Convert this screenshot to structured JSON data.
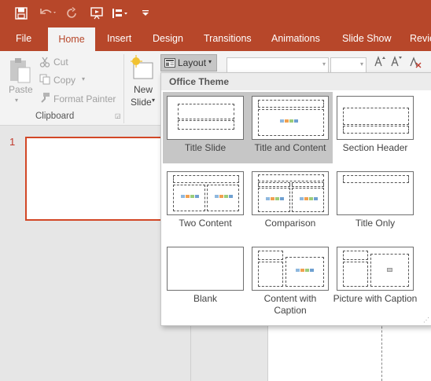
{
  "qat": {
    "buttons": [
      "save-icon",
      "undo-icon",
      "redo-icon",
      "start-from-beginning-icon",
      "section-icon",
      "customize-qat-icon"
    ]
  },
  "tabs": [
    {
      "label": "File"
    },
    {
      "label": "Home"
    },
    {
      "label": "Insert"
    },
    {
      "label": "Design"
    },
    {
      "label": "Transitions"
    },
    {
      "label": "Animations"
    },
    {
      "label": "Slide Show"
    },
    {
      "label": "Revie"
    }
  ],
  "ribbon": {
    "clipboard": {
      "paste_label": "Paste",
      "cut_label": "Cut",
      "copy_label": "Copy",
      "format_painter_label": "Format Painter",
      "group_label": "Clipboard"
    },
    "slides": {
      "new_slide_line1": "New",
      "new_slide_line2": "Slide",
      "layout_label": "Layout"
    }
  },
  "thumbnails": {
    "slide_number": "1"
  },
  "layout_gallery": {
    "title": "Office Theme",
    "selected": "Title and Content",
    "layouts": [
      {
        "name": "Title Slide"
      },
      {
        "name": "Title and Content"
      },
      {
        "name": "Section Header"
      },
      {
        "name": "Two Content"
      },
      {
        "name": "Comparison"
      },
      {
        "name": "Title Only"
      },
      {
        "name": "Blank"
      },
      {
        "name": "Content with Caption"
      },
      {
        "name": "Picture with Caption"
      }
    ]
  },
  "colors": {
    "accent": "#b7472a",
    "selection": "#c6c6c6",
    "thumbnail_border": "#d24726"
  }
}
